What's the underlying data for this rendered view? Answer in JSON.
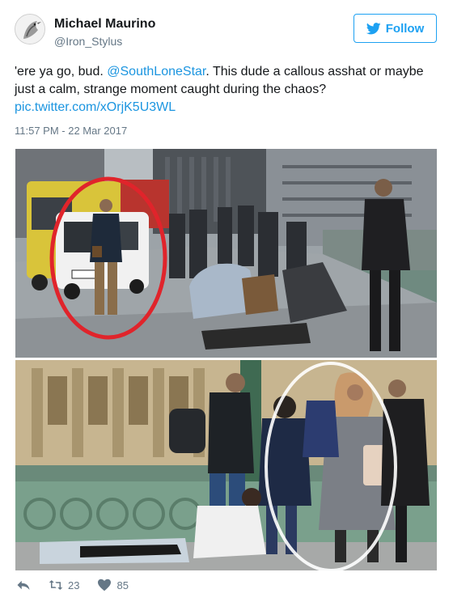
{
  "user": {
    "name": "Michael Maurino",
    "handle": "@Iron_Stylus"
  },
  "follow_label": "Follow",
  "tweet": {
    "text_before": "'ere ya go, bud. ",
    "mention": "@SouthLoneStar",
    "text_after": ". This dude a callous asshat or maybe just a calm, strange moment caught during the chaos?",
    "link": "pic.twitter.com/xOrjK5U3WL"
  },
  "timestamp": "11:57 PM - 22 Mar 2017",
  "stats": {
    "retweets": "23",
    "likes": "85"
  },
  "icons": {
    "follow": "twitter-bird-icon",
    "reply": "reply-icon",
    "retweet": "retweet-icon",
    "like": "heart-icon"
  },
  "colors": {
    "accent": "#1da1f2",
    "link": "#1b95e0",
    "muted": "#657786",
    "annotation": "#e0242b"
  }
}
